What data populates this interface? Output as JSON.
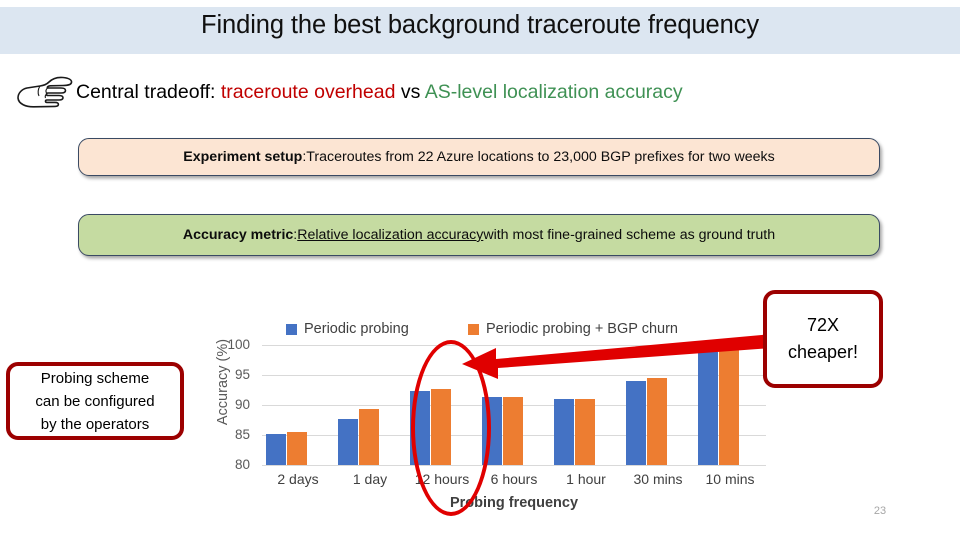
{
  "slide": {
    "title": "Finding the best background traceroute frequency",
    "page_number": "23",
    "title_band_color": "#dce6f1"
  },
  "bullet": {
    "icon": "pointing-hand-icon",
    "lead": "Central tradeoff: ",
    "emphasis_red": "traceroute overhead",
    "connector": " vs ",
    "emphasis_green": "AS-level localization accuracy",
    "red_color": "#c00000",
    "green_color": "#3f9154"
  },
  "callouts": [
    {
      "id": "experiment-setup",
      "label": "Experiment setup",
      "separator": ": ",
      "body": "Traceroutes from 22 Azure locations to 23,000 BGP prefixes for two weeks",
      "background": "#fce5d3",
      "border": "#3a4a63"
    },
    {
      "id": "accuracy-metric",
      "label": "Accuracy metric",
      "separator": ": ",
      "body_underlined": "Relative localization accuracy",
      "body_rest": " with most fine-grained scheme as ground truth",
      "background": "#c5dba1",
      "border": "#3a4a63"
    }
  ],
  "annotations": {
    "cheaper_box": {
      "line1": "72X",
      "line2": "cheaper!",
      "border_color": "#9c0000"
    },
    "probing_box": {
      "line1": "Probing scheme",
      "line2": "can be configured",
      "line3": "by the operators",
      "border_color": "#9c0000"
    },
    "ellipse": {
      "target": "12 hours",
      "color": "#e00000"
    },
    "arrow": {
      "direction": "left",
      "color": "#e00000"
    }
  },
  "chart_data": {
    "type": "bar",
    "title": "",
    "xlabel": "Probing frequency",
    "ylabel": "Accuracy (%)",
    "ylim": [
      80,
      100
    ],
    "yticks": [
      80,
      85,
      90,
      95,
      100
    ],
    "grid": true,
    "legend_position": "top",
    "categories": [
      "2 days",
      "1 day",
      "12 hours",
      "6 hours",
      "1 hour",
      "30 mins",
      "10 mins"
    ],
    "series": [
      {
        "name": "Periodic probing",
        "color": "#4472c4",
        "values": [
          85.2,
          87.7,
          92.4,
          91.4,
          91.0,
          94.0,
          98.9
        ]
      },
      {
        "name": "Periodic probing + BGP churn",
        "color": "#ed7d31",
        "values": [
          85.5,
          89.3,
          92.6,
          91.4,
          91.0,
          94.5,
          99.3
        ]
      }
    ]
  }
}
